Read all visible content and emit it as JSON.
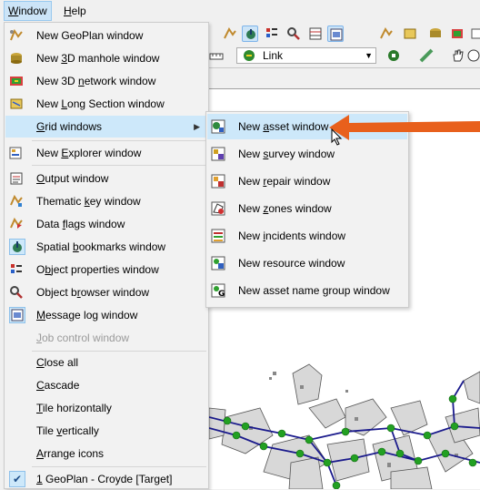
{
  "menubar": {
    "window_label": "Window",
    "window_underline": "W",
    "window_rest": "indow",
    "help_label": "Help",
    "help_underline": "H",
    "help_rest": "elp"
  },
  "toolbar": {
    "link_combo_value": "Link"
  },
  "window_menu": {
    "items": [
      {
        "label": "New GeoPlan window",
        "icon": "geoplan-window-icon"
      },
      {
        "label": "New 3D manhole window",
        "icon": "manhole-3d-icon"
      },
      {
        "label": "New 3D network window",
        "icon": "network-3d-icon"
      },
      {
        "label": "New Long Section window",
        "icon": "long-section-icon"
      },
      {
        "label": "Grid windows",
        "icon": "",
        "pre": "",
        "u": "G",
        "post": "rid windows"
      },
      {
        "label": "New Explorer window",
        "pre": "New ",
        "u": "E",
        "post": "xplorer window",
        "icon": "explorer-window-icon"
      },
      {
        "label": "Output window",
        "pre": "",
        "u": "O",
        "post": "utput window",
        "icon": "output-window-icon"
      },
      {
        "label": "Thematic key window",
        "icon": "thematic-key-icon"
      },
      {
        "label": "Data flags window",
        "icon": "data-flags-icon"
      },
      {
        "label": "Spatial bookmarks window",
        "icon": "spatial-bookmarks-icon"
      },
      {
        "label": "Object properties window",
        "pre": "O",
        "u": "b",
        "post": "ject properties window",
        "icon": "object-properties-icon"
      },
      {
        "label": "Object browser window",
        "icon": "object-browser-icon"
      },
      {
        "label": "Message log window",
        "pre": "",
        "u": "M",
        "post": "essage log window",
        "icon": "message-log-icon"
      },
      {
        "label": "Job control window",
        "pre": "",
        "u": "J",
        "post": "ob control window",
        "icon": ""
      },
      {
        "label": "Close all",
        "pre": "",
        "u": "C",
        "post": "lose all"
      },
      {
        "label": "Cascade",
        "pre": "",
        "u": "C",
        "post": "ascade"
      },
      {
        "label": "Tile horizontally",
        "pre": "",
        "u": "T",
        "post": "ile horizontally"
      },
      {
        "label": "Tile vertically",
        "pre": "Tile ",
        "u": "v",
        "post": "ertically"
      },
      {
        "label": "Arrange icons",
        "pre": "",
        "u": "A",
        "post": "rrange icons"
      },
      {
        "label": "1 GeoPlan - Croyde [Target]",
        "pre": "",
        "u": "1",
        "post": " GeoPlan - Croyde [Target]"
      }
    ]
  },
  "grid_submenu": {
    "items": [
      {
        "label": "New asset window",
        "pre": "New ",
        "u": "a",
        "post": "sset window",
        "icon": "asset-grid-icon"
      },
      {
        "label": "New survey window",
        "pre": "New ",
        "u": "s",
        "post": "urvey window",
        "icon": "survey-grid-icon"
      },
      {
        "label": "New repair window",
        "pre": "New ",
        "u": "r",
        "post": "epair window",
        "icon": "repair-grid-icon"
      },
      {
        "label": "New zones window",
        "pre": "New ",
        "u": "z",
        "post": "ones window",
        "icon": "zones-grid-icon"
      },
      {
        "label": "New incidents window",
        "pre": "New ",
        "u": "i",
        "post": "ncidents window",
        "icon": "incidents-grid-icon"
      },
      {
        "label": "New resource window",
        "icon": "resource-grid-icon"
      },
      {
        "label": "New asset name group window",
        "icon": "asset-name-group-icon"
      }
    ]
  },
  "colors": {
    "highlight": "#cde8fa",
    "annotation_arrow": "#e8601c",
    "network_node": "#22a022",
    "network_link": "#1a1a8c"
  }
}
